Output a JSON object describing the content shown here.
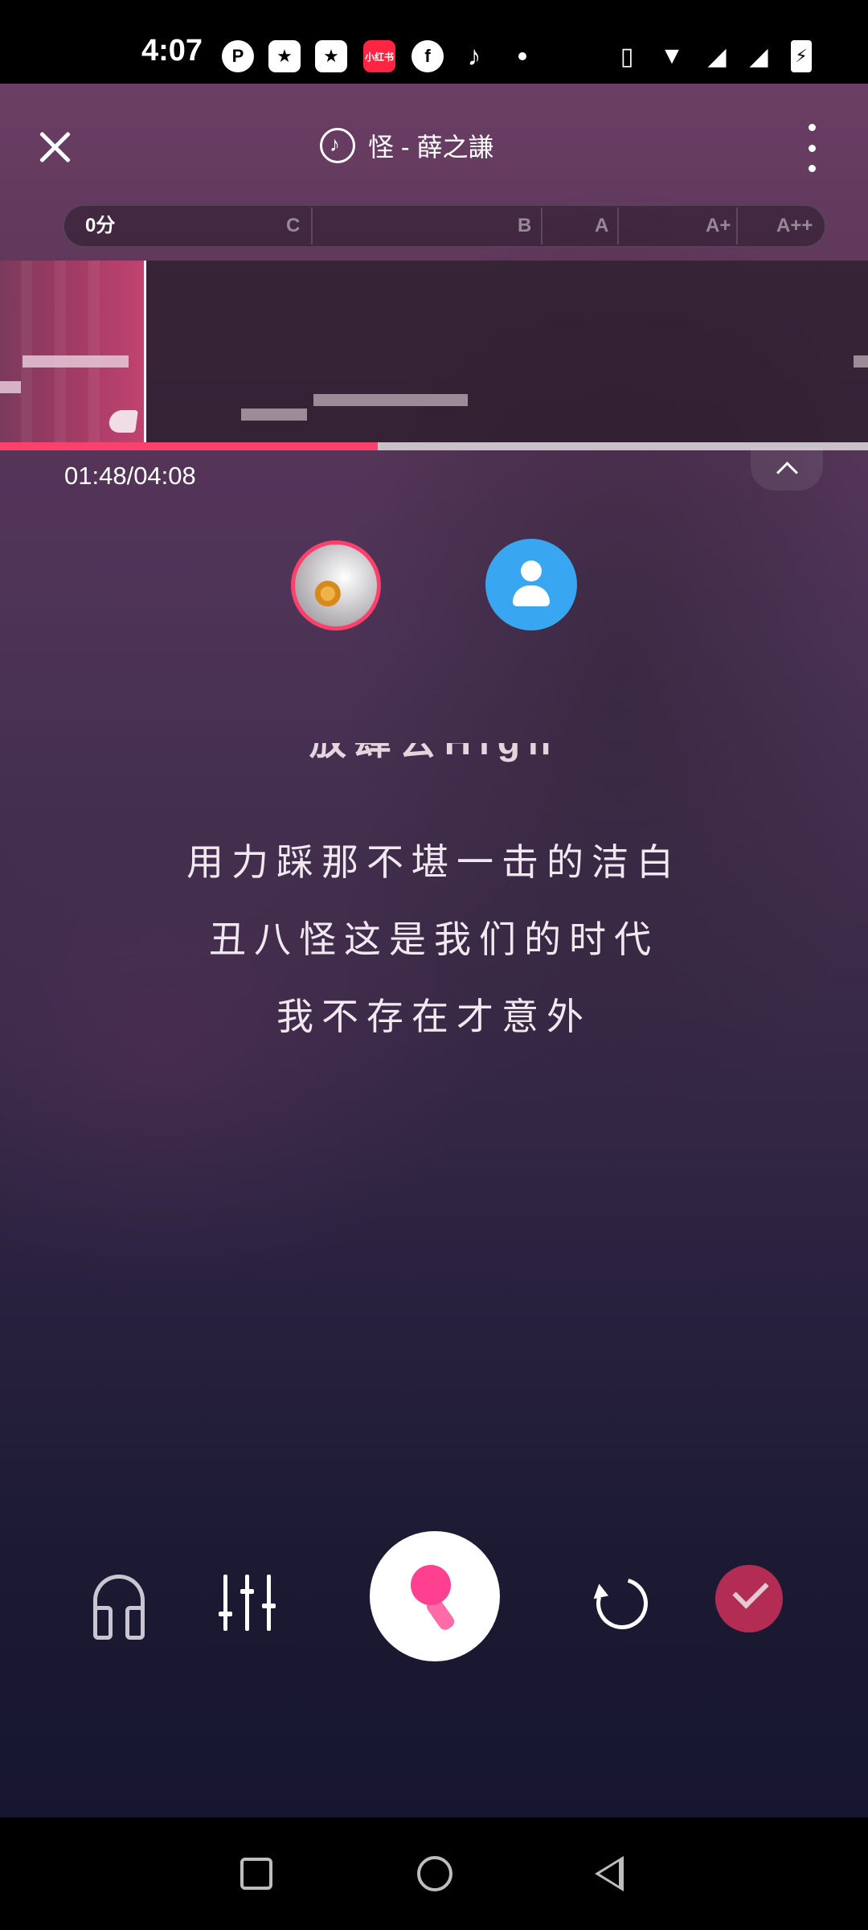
{
  "status_bar": {
    "time": "4:07",
    "notification_icons": [
      "app-icon-p",
      "star-app-icon",
      "star-app-icon",
      "xiaohongshu-icon",
      "facebook-icon",
      "tiktok-icon"
    ],
    "xiaohongshu_label": "小红书",
    "system_icons": [
      "vibrate-icon",
      "wifi-icon",
      "no-signal-icon",
      "no-signal-icon",
      "battery-charging-icon"
    ]
  },
  "header": {
    "song_title": "怪 - 薛之謙"
  },
  "score_bar": {
    "current_score": "0分",
    "grades": [
      "C",
      "B",
      "A",
      "A+",
      "A++"
    ]
  },
  "pitch": {
    "progress_fraction": 0.435
  },
  "playback": {
    "time": "01:48/04:08"
  },
  "lyrics": {
    "previous": "放肆去High",
    "lines": [
      "用力踩那不堪一击的洁白",
      "丑八怪这是我们的时代",
      "我不存在才意外"
    ]
  },
  "controls": {
    "icons": [
      "headphone-icon",
      "mixer-icon",
      "microphone-icon",
      "redo-icon",
      "check-icon"
    ]
  },
  "colors": {
    "accent": "#ff3f6c",
    "partner_avatar": "#38a6f0",
    "done_button": "#b32c54"
  }
}
